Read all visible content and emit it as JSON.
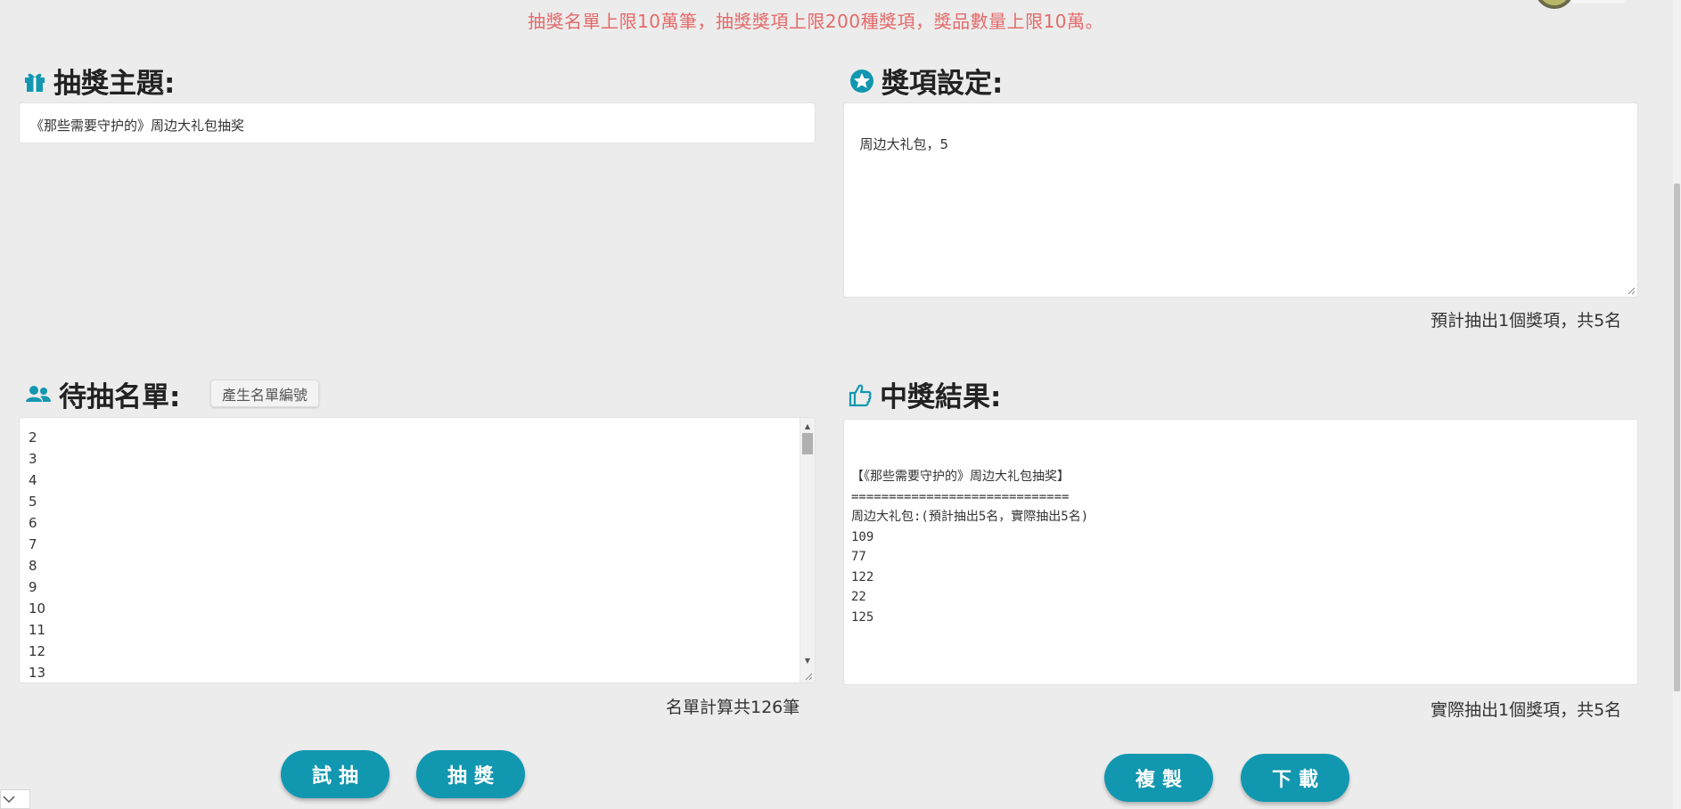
{
  "notice": "抽獎名單上限10萬筆，抽獎獎項上限200種獎項，獎品數量上限10萬。",
  "colors": {
    "accent": "#1297b0",
    "notice": "#e46a6a",
    "background": "#ececec"
  },
  "theme_section": {
    "title": "抽獎主題:",
    "icon": "gift-icon",
    "value": "《那些需要守护的》周边大礼包抽奖"
  },
  "prize_section": {
    "title": "獎項設定:",
    "icon": "star-icon",
    "value": "周边大礼包，5",
    "summary": "預計抽出1個獎項，共5名"
  },
  "list_section": {
    "title": "待抽名單:",
    "icon": "users-icon",
    "generate_button": "產生名單編號",
    "visible_rows": [
      "2",
      "3",
      "4",
      "5",
      "6",
      "7",
      "8",
      "9",
      "10",
      "11",
      "12",
      "13"
    ],
    "count_text": "名單計算共126筆"
  },
  "result_section": {
    "title": "中獎結果:",
    "icon": "thumbs-up-icon",
    "lines": [
      "【《那些需要守护的》周边大礼包抽奖】",
      "=============================",
      "周边大礼包:(預計抽出5名，實際抽出5名)",
      "109",
      "77",
      "122",
      "22",
      "125"
    ],
    "summary": "實際抽出1個獎項，共5名"
  },
  "buttons": {
    "trial": "試抽",
    "draw": "抽獎",
    "copy": "複製",
    "download": "下載"
  }
}
